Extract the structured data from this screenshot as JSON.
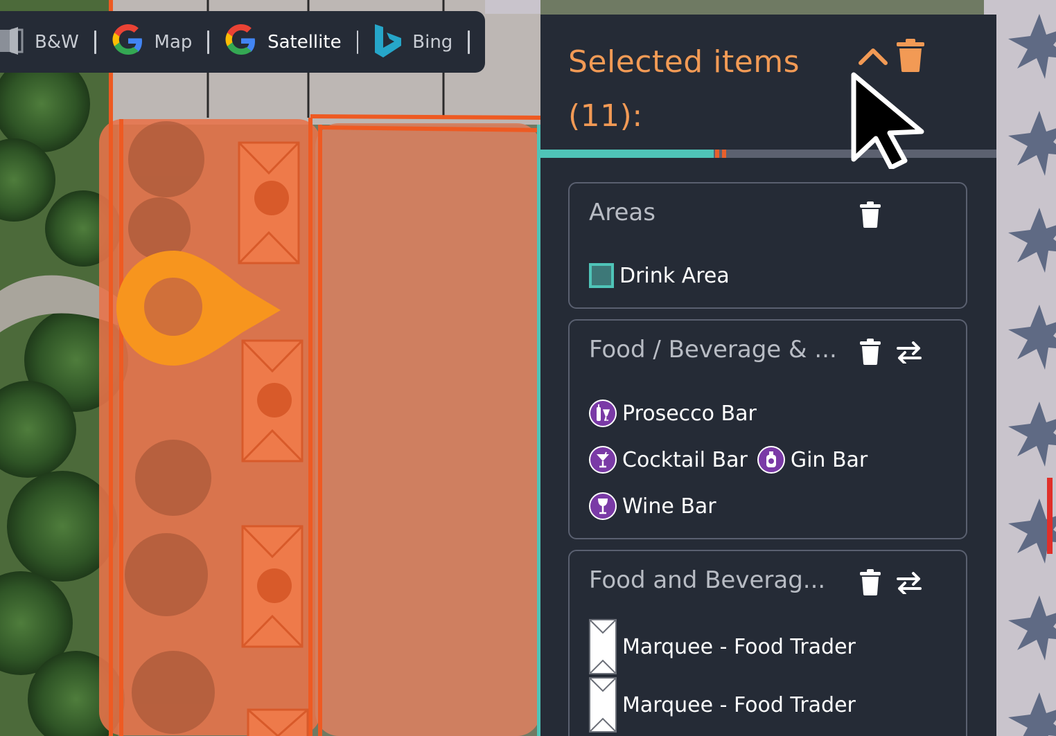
{
  "toolbar": {
    "items": [
      {
        "label": "B&W",
        "icon": "contrast-icon"
      },
      {
        "label": "Map",
        "icon": "google-icon"
      },
      {
        "label": "Satellite",
        "icon": "google-icon",
        "active": true
      },
      {
        "label": "Bing",
        "icon": "bing-icon"
      }
    ]
  },
  "panel": {
    "title": "Selected items (11):",
    "accent_color": "#f29a55",
    "background_color": "#252b36",
    "header_buttons": [
      "chevron-up-icon",
      "trash-icon"
    ],
    "groups": [
      {
        "title": "Areas",
        "buttons": [
          "trash-icon"
        ],
        "items": [
          {
            "label": "Drink Area",
            "icon": "area-swatch",
            "color": "#4fc4b8"
          }
        ]
      },
      {
        "title": "Food / Beverage & ...",
        "buttons": [
          "trash-icon",
          "swap-icon"
        ],
        "items": [
          {
            "label": "Prosecco Bar",
            "icon": "prosecco-icon"
          },
          {
            "label": "Cocktail Bar",
            "icon": "cocktail-icon"
          },
          {
            "label": "Gin Bar",
            "icon": "gin-icon"
          },
          {
            "label": "Wine Bar",
            "icon": "wine-icon"
          }
        ]
      },
      {
        "title": "Food and Beverag...",
        "buttons": [
          "trash-icon",
          "swap-icon"
        ],
        "items": [
          {
            "label": "Marquee - Food Trader",
            "icon": "marquee-icon"
          },
          {
            "label": "Marquee - Food Trader",
            "icon": "marquee-icon"
          }
        ]
      }
    ]
  },
  "map": {
    "area_color": "#e8734a",
    "outline_color": "#ee5a22",
    "pin_color": "#f7951e",
    "teal_color": "#4fc4b8"
  }
}
